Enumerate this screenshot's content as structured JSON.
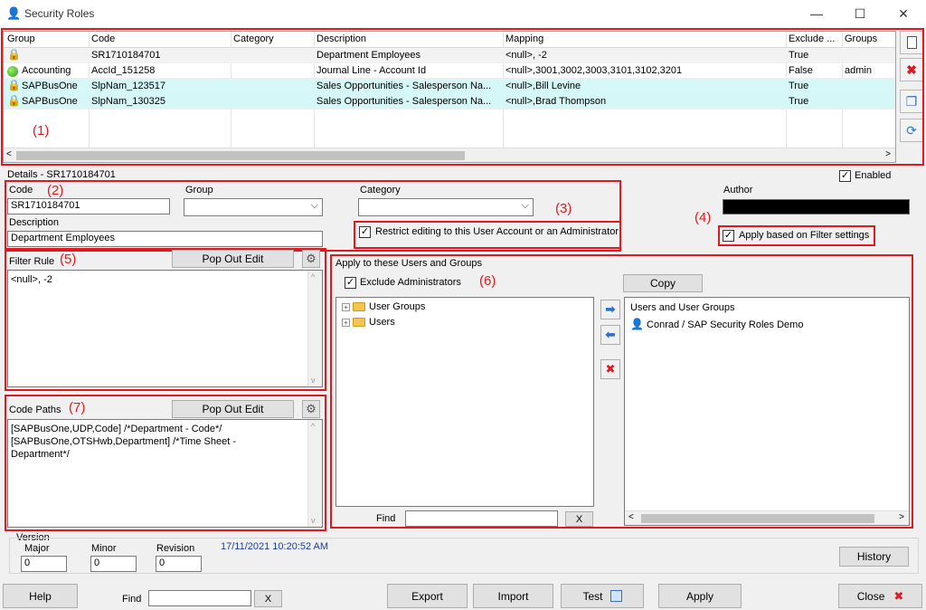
{
  "window": {
    "title": "Security Roles"
  },
  "grid": {
    "columns": [
      "Group",
      "Code",
      "Category",
      "Description",
      "Mapping",
      "Exclude ...",
      "Groups"
    ],
    "rows": [
      {
        "group": "",
        "code": "SR1710184701",
        "category": "",
        "description": "Department Employees",
        "mapping": "<null>, -2",
        "exclude": "True",
        "groups": ""
      },
      {
        "group": "Accounting",
        "code": "AccId_151258",
        "category": "",
        "description": "Journal Line - Account Id",
        "mapping": "<null>,3001,3002,3003,3101,3102,3201",
        "exclude": "False",
        "groups": "admin"
      },
      {
        "group": "SAPBusOne",
        "code": "SlpNam_123517",
        "category": "",
        "description": "Sales Opportunities - Salesperson Na...",
        "mapping": "<null>,Bill Levine",
        "exclude": "True",
        "groups": ""
      },
      {
        "group": "SAPBusOne",
        "code": "SlpNam_130325",
        "category": "",
        "description": "Sales Opportunities - Salesperson Na...",
        "mapping": "<null>,Brad Thompson",
        "exclude": "True",
        "groups": ""
      }
    ]
  },
  "annotations": {
    "a1": "(1)",
    "a2": "(2)",
    "a3": "(3)",
    "a4": "(4)",
    "a5": "(5)",
    "a6": "(6)",
    "a7": "(7)"
  },
  "details": {
    "header": "Details - SR1710184701",
    "enabled_label": "Enabled",
    "code_label": "Code",
    "code_value": "SR1710184701",
    "group_label": "Group",
    "category_label": "Category",
    "description_label": "Description",
    "description_value": "Department Employees",
    "restrict_label": "Restrict editing to this User Account or an Administrator",
    "author_label": "Author",
    "apply_filter_label": "Apply based on Filter settings"
  },
  "filter": {
    "label": "Filter Rule",
    "popout": "Pop Out Edit",
    "value": "<null>, -2"
  },
  "codepaths": {
    "label": "Code Paths",
    "popout": "Pop Out Edit",
    "lines": [
      "[SAPBusOne,UDP,Code]  /*Department - Code*/",
      "[SAPBusOne,OTSHwb,Department]  /*Time Sheet -",
      "Department*/"
    ]
  },
  "apply": {
    "title": "Apply to these Users and Groups",
    "exclude_admins": "Exclude Administrators",
    "copy": "Copy",
    "tree": [
      "User Groups",
      "Users"
    ],
    "right_header": "Users and User Groups",
    "right_items": [
      "Conrad / SAP Security Roles Demo"
    ],
    "find_label": "Find",
    "find_clear": "X"
  },
  "version": {
    "label": "Version",
    "major_label": "Major",
    "minor_label": "Minor",
    "revision_label": "Revision",
    "major": "0",
    "minor": "0",
    "revision": "0",
    "timestamp": "17/11/2021 10:20:52 AM",
    "history": "History"
  },
  "footer": {
    "help": "Help",
    "find_label": "Find",
    "find_clear": "X",
    "export": "Export",
    "import": "Import",
    "test": "Test",
    "apply": "Apply",
    "close": "Close"
  },
  "colors": {
    "accent_red": "#e0191e",
    "row_highlight": "#d6f7f7",
    "link_blue": "#1c3f9e"
  }
}
